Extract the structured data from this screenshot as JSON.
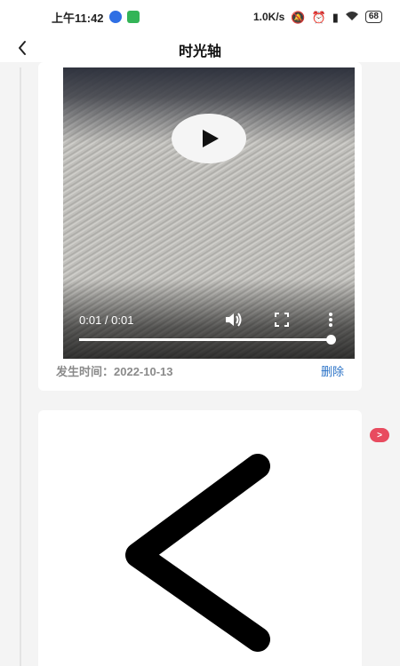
{
  "status_bar": {
    "time": "上午11:42",
    "net_speed": "1.0K/s",
    "battery": "68"
  },
  "nav": {
    "title": "时光轴"
  },
  "timeline_items": [
    {
      "type": "video",
      "time_display": "0:01 / 0:01",
      "progress": 1.0,
      "meta_label": "发生时间：",
      "meta_date": "2022-10-13",
      "delete_label": "删除"
    },
    {
      "type": "image",
      "icon": "chevron-left-icon"
    }
  ],
  "badge_label": ">",
  "colors": {
    "accent_link": "#2b73c7",
    "badge": "#e84b5f",
    "background": "#f4f4f4"
  }
}
